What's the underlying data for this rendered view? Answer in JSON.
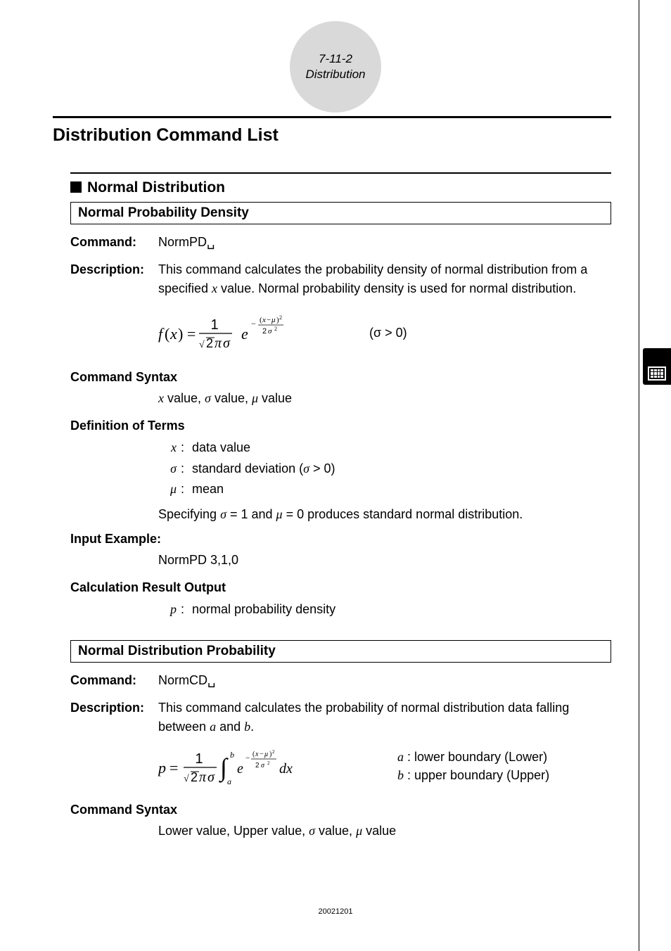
{
  "header": {
    "section_num": "7-11-2",
    "section_name": "Distribution"
  },
  "main_heading": "Distribution Command List",
  "normal_dist": {
    "heading": "Normal Distribution",
    "npd": {
      "box_title": "Normal Probability Density",
      "command_label": "Command:",
      "command_value": "NormPD␣",
      "description_label": "Description:",
      "description_value_pre": "This command calculates the probability density of normal distribution from a specified ",
      "description_var": "x",
      "description_value_post": " value. Normal probability density is used for normal distribution.",
      "sigma_cond": "(σ > 0)",
      "syntax_label": "Command Syntax",
      "syntax_value": "x value, σ value, μ value",
      "terms_label": "Definition of Terms",
      "term_x_sym": "x",
      "term_x_val": "data value",
      "term_sigma_sym": "σ",
      "term_sigma_val": "standard deviation (σ > 0)",
      "term_mu_sym": "μ",
      "term_mu_val": "mean",
      "note": "Specifying σ = 1 and μ = 0 produces standard normal distribution.",
      "input_label": "Input Example:",
      "input_value": "NormPD  3,1,0",
      "output_label": "Calculation Result Output",
      "output_sym": "p",
      "output_val": "normal probability density"
    },
    "ndp": {
      "box_title": "Normal Distribution Probability",
      "command_label": "Command:",
      "command_value": "NormCD␣",
      "description_label": "Description:",
      "description_value_pre": "This command calculates the probability of normal distribution data falling between ",
      "description_var_a": "a",
      "description_and": " and ",
      "description_var_b": "b",
      "description_period": ".",
      "boundary_a_sym": "a",
      "boundary_a_text": " : lower boundary (Lower)",
      "boundary_b_sym": "b",
      "boundary_b_text": " : upper boundary (Upper)",
      "syntax_label": "Command Syntax",
      "syntax_value": "Lower value, Upper value, σ value, μ value"
    }
  },
  "footer_num": "20021201"
}
